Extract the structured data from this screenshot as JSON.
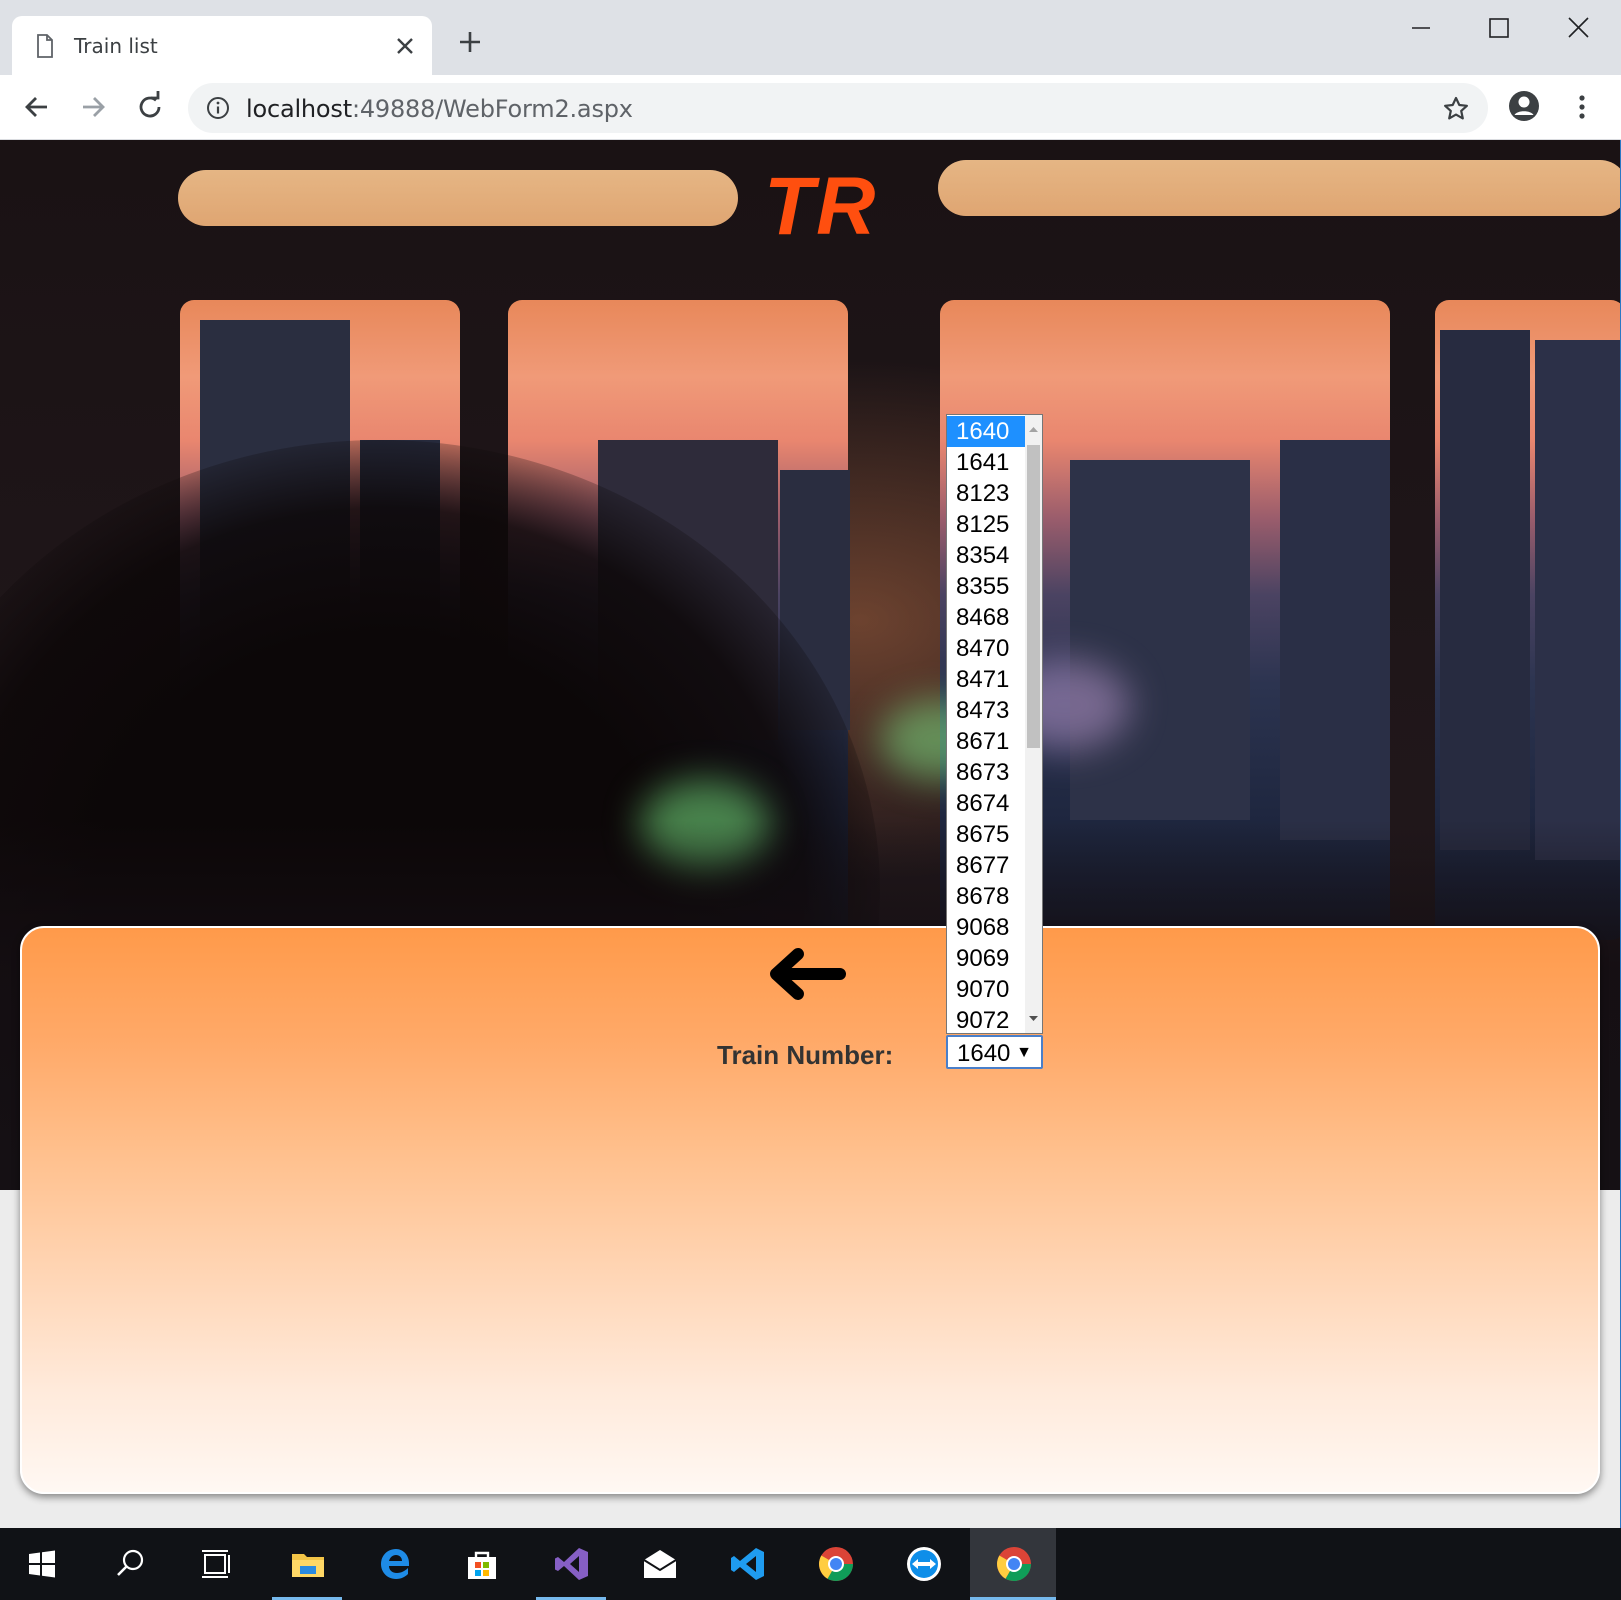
{
  "browser": {
    "tab_title": "Train list",
    "url_host": "localhost",
    "url_path": ":49888/WebForm2.aspx"
  },
  "page": {
    "logo_text": "TR",
    "train_number_label": "Train Number:",
    "selected_train": "1640",
    "train_options": [
      "1640",
      "1641",
      "8123",
      "8125",
      "8354",
      "8355",
      "8468",
      "8470",
      "8471",
      "8473",
      "8671",
      "8673",
      "8674",
      "8675",
      "8677",
      "8678",
      "9068",
      "9069",
      "9070",
      "9072"
    ],
    "highlighted_option_index": 0
  },
  "taskbar": {
    "items": [
      "start-icon",
      "search-icon",
      "task-view-icon",
      "file-explorer-icon",
      "edge-icon",
      "store-icon",
      "visual-studio-icon",
      "mail-icon",
      "vscode-icon",
      "chrome-icon",
      "teamviewer-icon",
      "chrome-active-icon"
    ]
  },
  "colors": {
    "logo": "#ff4f0f",
    "panel_top": "#ff9a4a",
    "selection": "#1e90ff",
    "window_border": "#2b78c5"
  }
}
